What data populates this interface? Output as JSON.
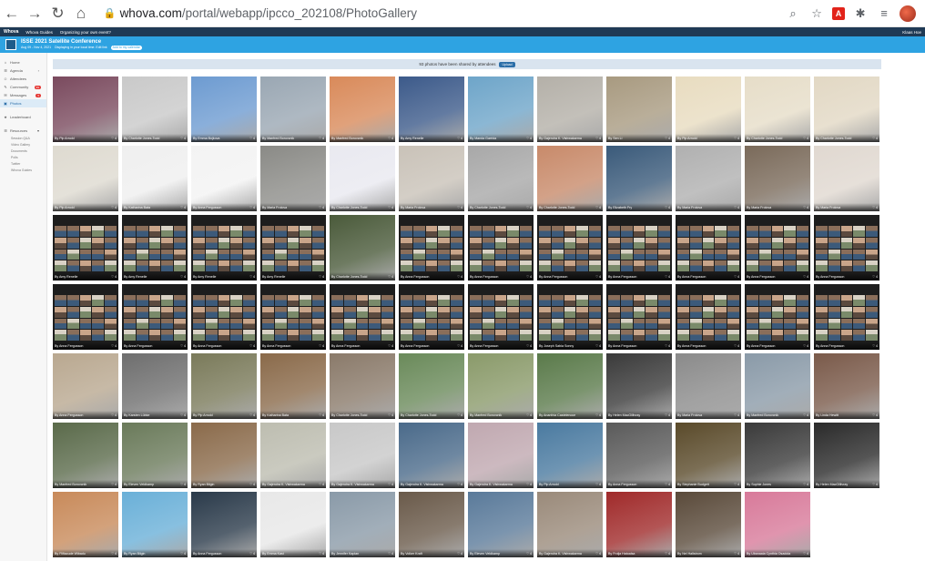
{
  "browser": {
    "url_main": "whova.com",
    "url_rest": "/portal/webapp/ipcco_202108/PhotoGallery"
  },
  "topbar": {
    "logo": "Whova",
    "link1": "Whova Guides",
    "link2": "Organizing your own event?",
    "user": "Klaas Hoe"
  },
  "event": {
    "title": "ISSE 2021 Satellite Conference",
    "dates": "Aug 09 - Nov 4, 2021",
    "note": "Displaying in your local time. Edit link",
    "pill": "Add to my calendar"
  },
  "sidebar": {
    "items": [
      {
        "icon": "⌂",
        "label": "Home",
        "active": false
      },
      {
        "icon": "☰",
        "label": "Agenda",
        "chevron": "›",
        "active": false
      },
      {
        "icon": "☺",
        "label": "Attendees",
        "active": false
      },
      {
        "icon": "✎",
        "label": "Community",
        "badge": "99",
        "active": false
      },
      {
        "icon": "✉",
        "label": "Messages",
        "badge": "5",
        "active": false
      },
      {
        "icon": "▣",
        "label": "Photos",
        "active": true
      }
    ],
    "leaderboard": {
      "icon": "★",
      "label": "Leaderboard"
    },
    "resources": {
      "icon": "☰",
      "label": "Resources",
      "chevron": "▾"
    },
    "sub": [
      "Session Q&A",
      "Video Gallery",
      "Documents",
      "Polls",
      "Twitter",
      "Whova Guides"
    ]
  },
  "gallery": {
    "notice": "93 photos have been shared by attendees",
    "upload": "Upload",
    "rows": [
      [
        "By Pip Arnold",
        "By Charlotte Jones-Todd",
        "By Emma Bojkova",
        "By Manfred Borovcnik",
        "By Manfred Borovcnik",
        "By Amy Renelle",
        "By Manda Garrida",
        "By Gajendra K. Vishwakarma",
        "By Sen Li",
        "By Pip Arnold",
        "By Charlotte Jones-Todd",
        "By Charlotte Jones-Todd"
      ],
      [
        "By Pip Arnold",
        "By Katharina Bata",
        "By Anna Fergusson",
        "By Maria Frolova",
        "By Charlotte Jones-Todd",
        "By Maria Frolova",
        "By Charlotte Jones-Todd",
        "By Charlotte Jones-Todd",
        "By Elizabeth Fry",
        "By Maria Frolova",
        "By Maria Frolova",
        "By Maria Frolova"
      ],
      [
        "By Amy Renelle",
        "By Amy Renelle",
        "By Amy Renelle",
        "By Amy Renelle",
        "By Charlotte Jones-Todd",
        "By Anna Fergusson",
        "By Anna Fergusson",
        "By Anna Fergusson",
        "By Anna Fergusson",
        "By Anna Fergusson",
        "By Anna Fergusson",
        "By Anna Fergusson"
      ],
      [
        "By Anna Fergusson",
        "By Anna Fergusson",
        "By Anna Fergusson",
        "By Anna Fergusson",
        "By Anna Fergusson",
        "By Anna Fergusson",
        "By Anna Fergusson",
        "By Joseph Sabia Sonny",
        "By Anna Fergusson",
        "By Anna Fergusson",
        "By Anna Fergusson",
        "By Anna Fergusson"
      ],
      [
        "By Anna Fergusson",
        "By Karsten Lübke",
        "By Pip Arnold",
        "By Katharina Bata",
        "By Charlotte Jones-Todd",
        "By Charlotte Jones-Todd",
        "By Manfred Borovcnik",
        "By Ananthia Castelenoce",
        "By Helen MacGillivray",
        "By Maria Frolova",
        "By Manfred Borovcnik",
        "By Linda Hewitt"
      ],
      [
        "By Manfred Borovcnik",
        "By Eleven Veldkamp",
        "By Ryan Bilgin",
        "By Gajendra K. Vishwakarma",
        "By Gajendra K. Vishwakarma",
        "By Gajendra K. Vishwakarma",
        "By Gajendra K. Vishwakarma",
        "By Pip Arnold",
        "By Anna Fergusson",
        "By Stephanie Budgett",
        "By Sophie Jones",
        "By Helen MacGillivray"
      ],
      [
        "By Fiifiacude Wibadu",
        "By Ryan Bilgin",
        "By Anna Fergusson",
        "By Emma Kast",
        "By Jennifer Kaplan",
        "By Volker Kraft",
        "By Eleven Veldkamp",
        "By Gajendra K. Vishwakarma",
        "By Frolja Hatoalsa",
        "By Nel Hallstrom",
        "By Ubanaaia Cynthia Osadola"
      ]
    ],
    "likes": "♡ 4"
  }
}
